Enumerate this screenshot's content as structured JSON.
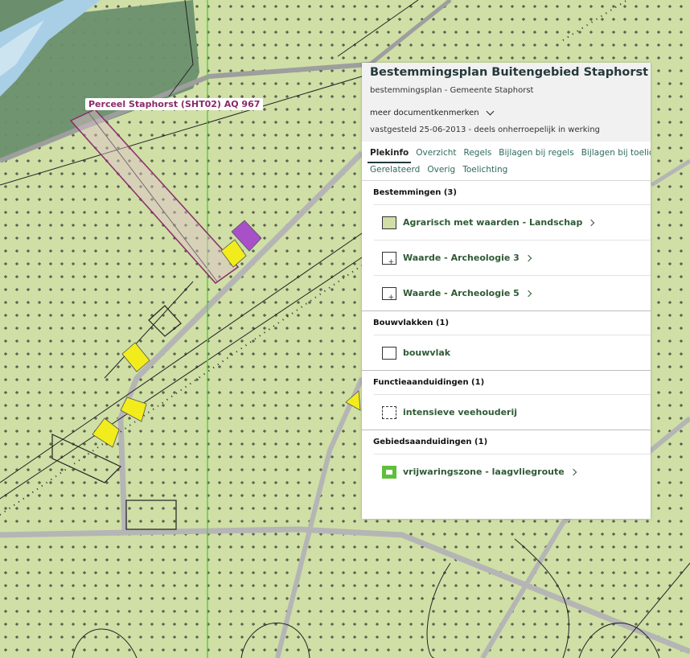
{
  "map": {
    "parcel_label": "Perceel Staphorst (SHT02) AQ 967"
  },
  "panel": {
    "title": "Bestemmingsplan Buitengebied Staphorst",
    "subtitle": "bestemmingsplan - Gemeente Staphorst",
    "meta_toggle": "meer documentkenmerken",
    "status": "vastgesteld 25-06-2013 - deels onherroepelijk in werking",
    "tabs_row1": [
      "Plekinfo",
      "Overzicht",
      "Regels",
      "Bijlagen bij regels",
      "Bijlagen bij toelichting"
    ],
    "tabs_row2": [
      "Gerelateerd",
      "Overig",
      "Toelichting"
    ],
    "active_tab": "Plekinfo",
    "sections": {
      "bestemmingen": {
        "title": "Bestemmingen (3)",
        "items": [
          "Agrarisch met waarden - Landschap",
          "Waarde - Archeologie 3",
          "Waarde - Archeologie 5"
        ]
      },
      "bouwvlakken": {
        "title": "Bouwvlakken (1)",
        "items": [
          "bouwvlak"
        ]
      },
      "functie": {
        "title": "Functieaanduidingen (1)",
        "items": [
          "intensieve veehouderij"
        ]
      },
      "gebied": {
        "title": "Gebiedsaanduidingen (1)",
        "items": [
          "vrijwaringszone - laagvliegroute"
        ]
      }
    }
  },
  "colors": {
    "map_bg": "#cfdfa6",
    "forest": "#6b8f6d",
    "water": "#a9cfe6",
    "parcel_outline": "#8a2b68",
    "yellow_bouwvlak": "#f2ec1c",
    "purple_zone": "#a750c8",
    "accent_green": "#2f5a35"
  },
  "icons": {
    "meta_toggle": "chevron-down-icon",
    "item_arrow": "chevron-right-icon"
  }
}
